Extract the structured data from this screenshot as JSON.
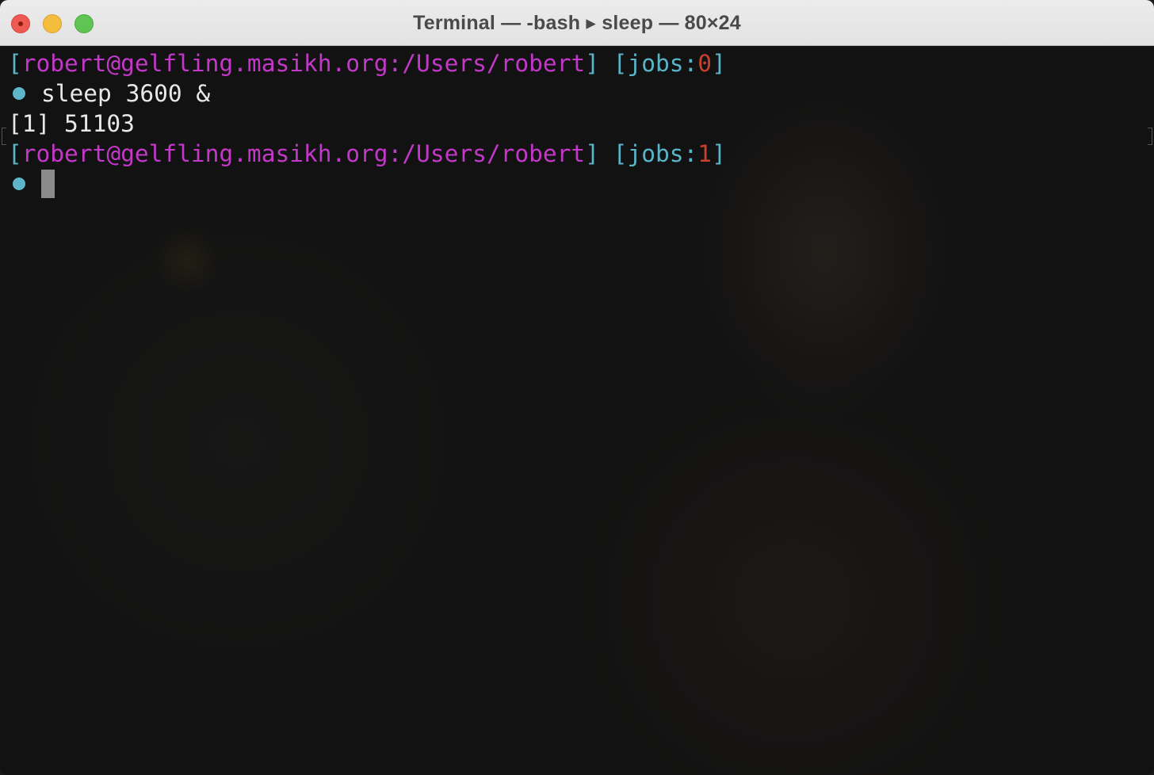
{
  "window": {
    "title": "Terminal — -bash ▸ sleep — 80×24"
  },
  "colors": {
    "prompt_bracket": "#59b6c9",
    "prompt_host": "#c338c9",
    "jobs_count": "#c8402e",
    "text": "#e8e8e8",
    "background": "#121212"
  },
  "terminal": {
    "prompt1": {
      "open_bracket": "[",
      "user_host_path": "robert@gelfling.masikh.org:/Users/robert",
      "close_bracket_space": "] ",
      "jobs_open": "[jobs:",
      "jobs_count": "0",
      "jobs_close": "]"
    },
    "command1": "sleep 3600 &",
    "output1": "[1] 51103",
    "prompt2": {
      "open_bracket": "[",
      "user_host_path": "robert@gelfling.masikh.org:/Users/robert",
      "close_bracket_space": "] ",
      "jobs_open": "[jobs:",
      "jobs_count": "1",
      "jobs_close": "]"
    }
  }
}
